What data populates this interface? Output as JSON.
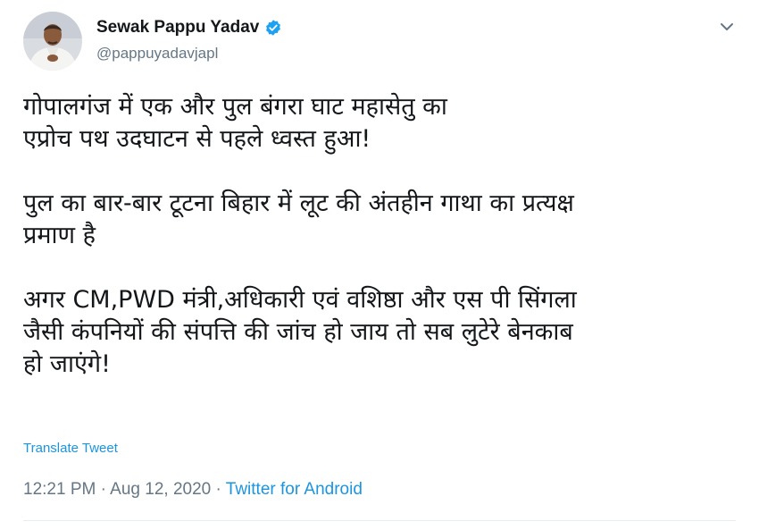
{
  "user": {
    "display_name": "Sewak Pappu Yadav",
    "handle": "@pappuyadavjapl",
    "verified": true
  },
  "icons": {
    "verified": "verified-badge-icon",
    "caret": "chevron-down-icon"
  },
  "tweet": {
    "paragraphs": [
      {
        "lines": [
          "गोपालगंज में एक और पुल बंगरा घाट महासेतु का",
          "एप्रोच पथ उदघाटन से पहले ध्वस्त हुआ!"
        ]
      },
      {
        "lines": [
          "पुल का बार-बार टूटना बिहार में लूट की अंतहीन गाथा का प्रत्यक्ष",
          "प्रमाण है"
        ]
      },
      {
        "lines": [
          "अगर CM,PWD मंत्री,अधिकारी एवं वशिष्ठा और एस पी सिंगला",
          "जैसी कंपनियों की संपत्ति की जांच हो जाय तो सब लुटेरे बेनकाब",
          "हो जाएंगे!"
        ]
      }
    ],
    "translate_label": "Translate Tweet",
    "time": "12:21 PM",
    "separator": " · ",
    "date": "Aug 12, 2020",
    "source": "Twitter for Android"
  },
  "colors": {
    "link": "#1b95e0",
    "muted": "#657786",
    "text": "#14171a",
    "verified": "#1da1f2"
  }
}
